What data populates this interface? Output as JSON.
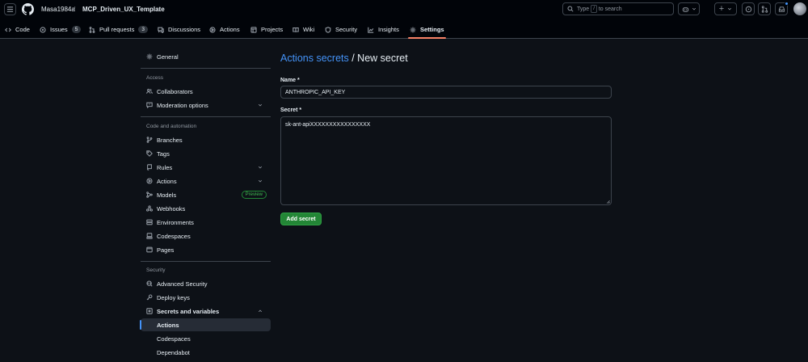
{
  "header": {
    "owner": "Masa1984a",
    "separator": "/",
    "repo": "MCP_Driven_UX_Template",
    "search_prefix": "Type",
    "search_key": "/",
    "search_suffix": "to search",
    "add_label": "+"
  },
  "tabs": [
    {
      "label": "Code",
      "icon": "code-icon"
    },
    {
      "label": "Issues",
      "icon": "issue-icon",
      "count": "5"
    },
    {
      "label": "Pull requests",
      "icon": "pull-request-icon",
      "count": "3"
    },
    {
      "label": "Discussions",
      "icon": "discussion-icon"
    },
    {
      "label": "Actions",
      "icon": "play-icon"
    },
    {
      "label": "Projects",
      "icon": "table-icon"
    },
    {
      "label": "Wiki",
      "icon": "book-icon"
    },
    {
      "label": "Security",
      "icon": "shield-icon"
    },
    {
      "label": "Insights",
      "icon": "graph-icon"
    },
    {
      "label": "Settings",
      "icon": "gear-icon",
      "selected": true
    }
  ],
  "sidebar": {
    "general": "General",
    "access_heading": "Access",
    "collaborators": "Collaborators",
    "moderation": "Moderation options",
    "code_heading": "Code and automation",
    "branches": "Branches",
    "tags": "Tags",
    "rules": "Rules",
    "actions": "Actions",
    "models": "Models",
    "models_badge": "Preview",
    "webhooks": "Webhooks",
    "environments": "Environments",
    "codespaces": "Codespaces",
    "pages": "Pages",
    "security_heading": "Security",
    "advanced_security": "Advanced Security",
    "deploy_keys": "Deploy keys",
    "secrets_variables": "Secrets and variables",
    "sub_actions": "Actions",
    "sub_codespaces": "Codespaces",
    "sub_dependabot": "Dependabot"
  },
  "main": {
    "breadcrumb_link": "Actions secrets",
    "breadcrumb_rest": " / New secret",
    "name_label": "Name *",
    "name_value": "ANTHROPIC_API_KEY",
    "secret_label": "Secret *",
    "secret_value": "sk-ant-apiXXXXXXXXXXXXXXXX",
    "submit_label": "Add secret"
  },
  "colors": {
    "background": "#0d1117",
    "header": "#010409",
    "accent_link": "#4493f8",
    "primary_button": "#238636",
    "selected_tab_underline": "#f78166"
  }
}
